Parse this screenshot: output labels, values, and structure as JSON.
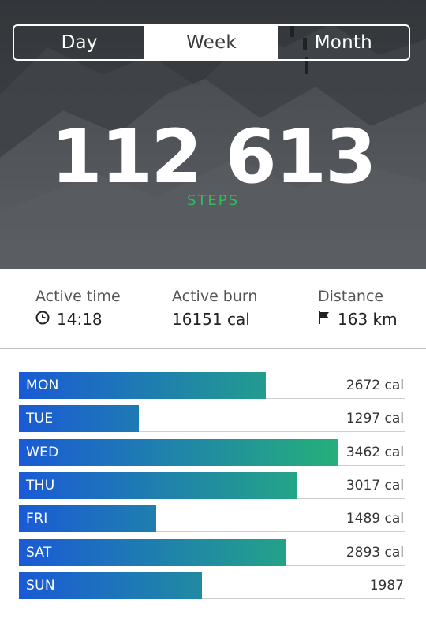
{
  "tabs": [
    {
      "label": "Day",
      "active": false
    },
    {
      "label": "Week",
      "active": true
    },
    {
      "label": "Month",
      "active": false
    }
  ],
  "steps": {
    "value": "112 613",
    "label": "STEPS",
    "label_color": "#2fbf5b"
  },
  "stats": [
    {
      "label": "Active time",
      "value": "14:18",
      "icon": "clock-icon"
    },
    {
      "label": "Active burn",
      "value": "16151 cal",
      "icon": null
    },
    {
      "label": "Distance",
      "value": "163 km",
      "icon": "flag-icon"
    }
  ],
  "week": {
    "max_value": 3462,
    "gradient_start": "#1a5ad6",
    "gradient_end": "#25b07a",
    "days": [
      {
        "day": "MON",
        "value": 2672,
        "cal_text": "2672 cal"
      },
      {
        "day": "TUE",
        "value": 1297,
        "cal_text": "1297 cal"
      },
      {
        "day": "WED",
        "value": 3462,
        "cal_text": "3462 cal"
      },
      {
        "day": "THU",
        "value": 3017,
        "cal_text": "3017 cal"
      },
      {
        "day": "FRI",
        "value": 1489,
        "cal_text": "1489 cal"
      },
      {
        "day": "SAT",
        "value": 2893,
        "cal_text": "2893 cal"
      },
      {
        "day": "SUN",
        "value": 1987,
        "cal_text": "1987"
      }
    ]
  }
}
